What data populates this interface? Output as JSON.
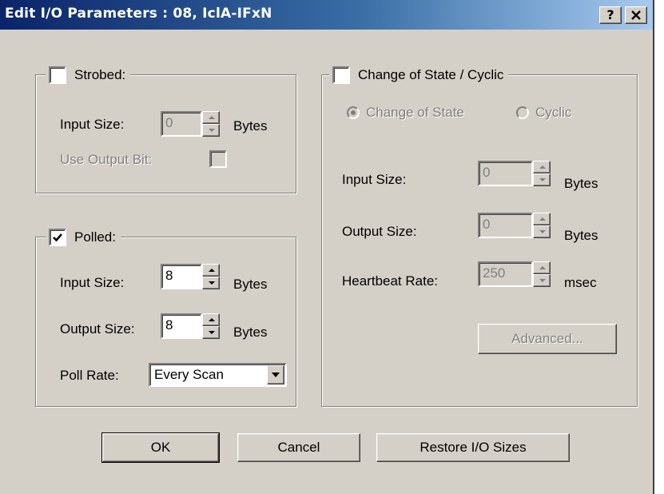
{
  "window": {
    "title": "Edit I/O Parameters : 08, IclA-IFxN",
    "help_button": "?",
    "close_button": "×"
  },
  "strobed": {
    "label": "Strobed:",
    "checked": false,
    "input_size_label": "Input Size:",
    "input_size_value": "0",
    "input_size_unit": "Bytes",
    "use_output_bit_label": "Use Output Bit:",
    "use_output_bit_checked": false
  },
  "polled": {
    "label": "Polled:",
    "checked": true,
    "input_size_label": "Input Size:",
    "input_size_value": "8",
    "input_size_unit": "Bytes",
    "output_size_label": "Output Size:",
    "output_size_value": "8",
    "output_size_unit": "Bytes",
    "poll_rate_label": "Poll Rate:",
    "poll_rate_value": "Every Scan"
  },
  "cos": {
    "label": "Change of State / Cyclic",
    "checked": false,
    "radio_cos_label": "Change of State",
    "radio_cos_selected": true,
    "radio_cyclic_label": "Cyclic",
    "radio_cyclic_selected": false,
    "input_size_label": "Input Size:",
    "input_size_value": "0",
    "input_size_unit": "Bytes",
    "output_size_label": "Output Size:",
    "output_size_value": "0",
    "output_size_unit": "Bytes",
    "heartbeat_label": "Heartbeat Rate:",
    "heartbeat_value": "250",
    "heartbeat_unit": "msec",
    "advanced_label": "Advanced..."
  },
  "buttons": {
    "ok": "OK",
    "cancel": "Cancel",
    "restore": "Restore I/O Sizes"
  },
  "colors": {
    "face": "#d4d0c8",
    "title_start": "#0a246a",
    "title_end": "#a6caf0",
    "disabled_text": "#808080"
  }
}
